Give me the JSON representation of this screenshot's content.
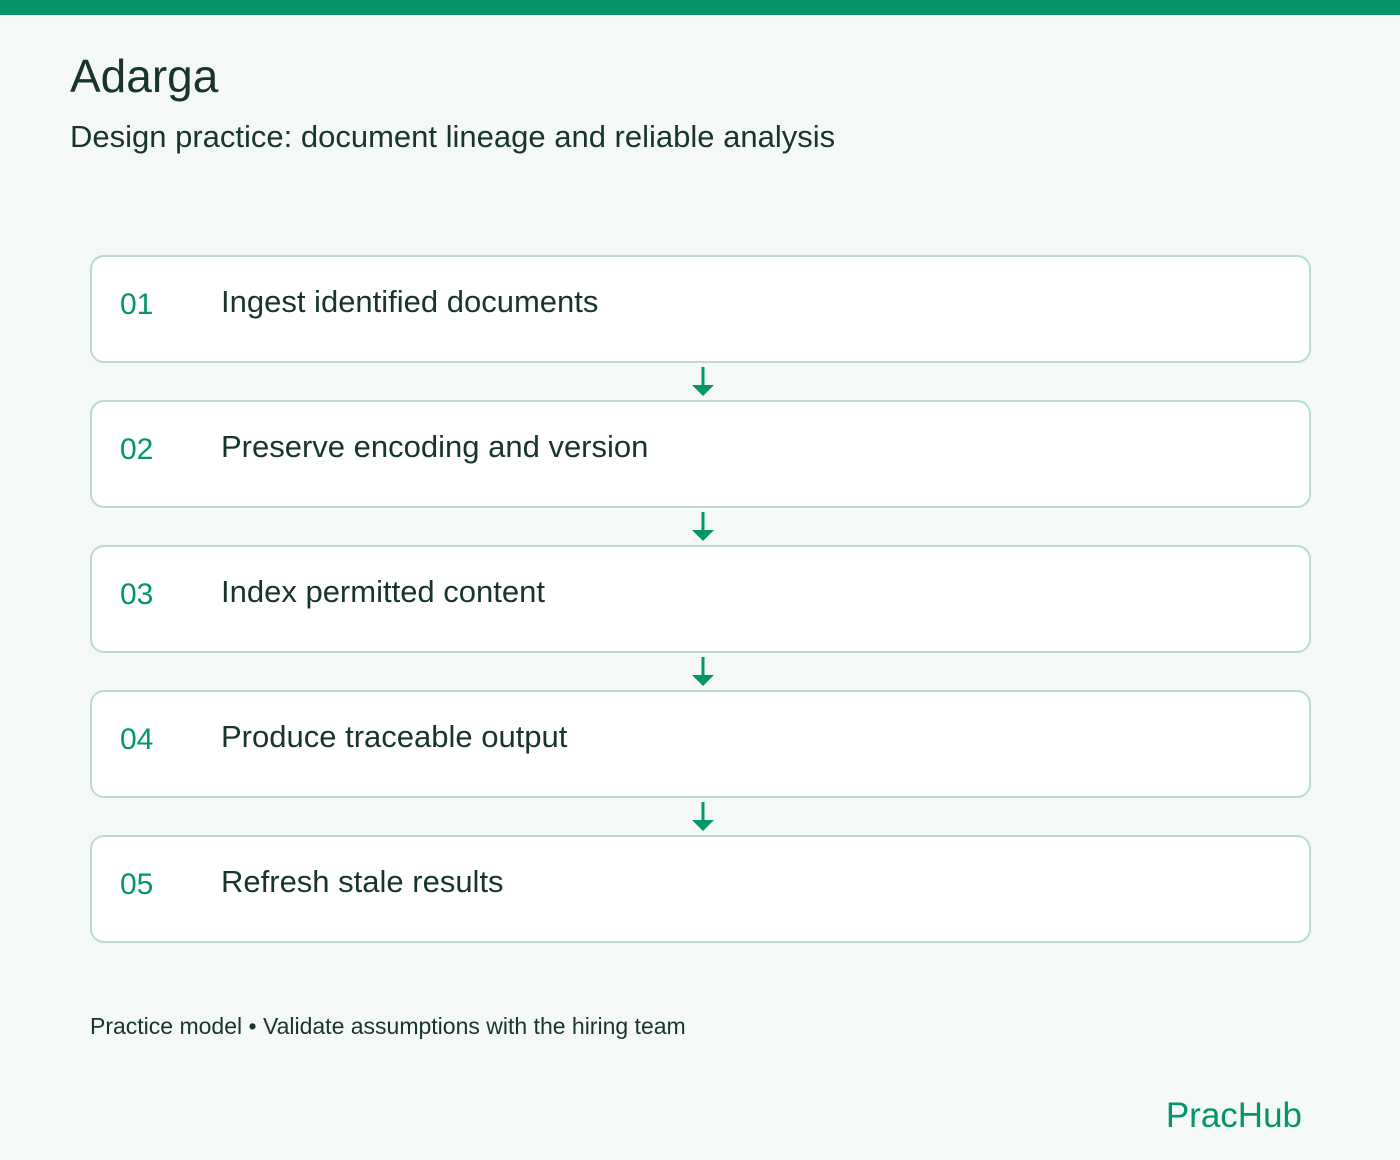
{
  "header": {
    "title": "Adarga",
    "subtitle": "Design practice: document lineage and reliable analysis"
  },
  "steps": [
    {
      "number": "01",
      "label": "Ingest identified documents"
    },
    {
      "number": "02",
      "label": "Preserve encoding and version"
    },
    {
      "number": "03",
      "label": "Index permitted content"
    },
    {
      "number": "04",
      "label": "Produce traceable output"
    },
    {
      "number": "05",
      "label": "Refresh stale results"
    }
  ],
  "footer": {
    "note": "Practice model • Validate assumptions with the hiring team",
    "brand": "PracHub"
  },
  "colors": {
    "accent": "#05956a",
    "background": "#f4f8f7",
    "card_border": "#b9dbd1",
    "text": "#17352e"
  },
  "icons": {
    "connector": "arrow-down-icon"
  }
}
